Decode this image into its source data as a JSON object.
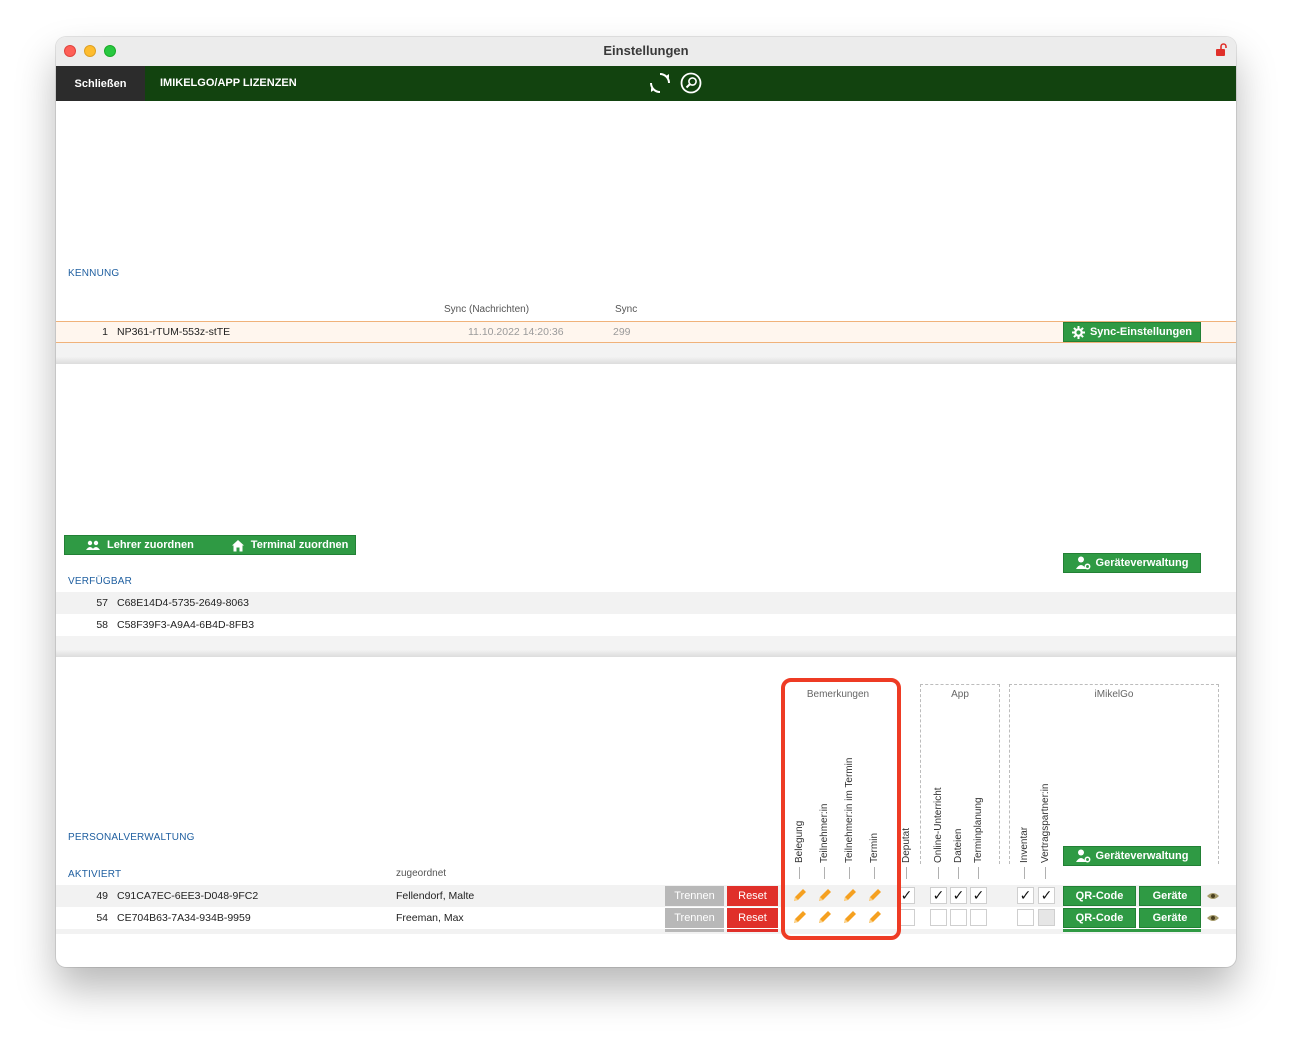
{
  "window": {
    "title": "Einstellungen"
  },
  "toolbar": {
    "close_label": "Schließen",
    "licenses_label": "IMIKELGO/APP LIZENZEN"
  },
  "kennung": {
    "label": "KENNUNG",
    "col_sync_messages": "Sync (Nachrichten)",
    "col_sync": "Sync",
    "row": {
      "num": "1",
      "id": "NP361-rTUM-553z-stTE",
      "sync_messages": "11.10.2022 14:20:36",
      "sync": "299"
    },
    "sync_settings_button": "Sync-Einstellungen"
  },
  "assign": {
    "teacher_button": "Lehrer zuordnen",
    "terminal_button": "Terminal zuordnen",
    "device_mgmt_button": "Geräteverwaltung"
  },
  "available": {
    "label": "VERFÜGBAR",
    "rows": [
      {
        "num": "57",
        "id": "C68E14D4-5735-2649-8063"
      },
      {
        "num": "58",
        "id": "C58F39F3-A9A4-6B4D-8FB3"
      }
    ]
  },
  "personnel": {
    "label": "PERSONALVERWALTUNG",
    "active_label": "AKTIVIERT",
    "assigned_header": "zugeordnet",
    "groups": {
      "remarks": "Bemerkungen",
      "app": "App",
      "imikelgo": "iMikelGo"
    },
    "columns": {
      "belegung": "Belegung",
      "teilnehmer": "Teilnehmer:in",
      "teilnehmer_termin": "Teilnehmer:in im Termin",
      "termin": "Termin",
      "deputat": "Deputat",
      "online": "Online-Unterricht",
      "dateien": "Dateien",
      "terminplanung": "Terminplanung",
      "inventar": "Inventar",
      "vertragspartner": "Vertragspartner:in"
    },
    "device_mgmt_button": "Geräteverwaltung",
    "rows": [
      {
        "num": "49",
        "id": "C91CA7EC-6EE3-D048-9FC2",
        "assigned": "Fellendorf, Malte",
        "disconnect": "Trennen",
        "reset": "Reset",
        "qr": "QR-Code",
        "devices": "Geräte",
        "deputat": true,
        "online": true,
        "dateien": true,
        "terminplanung": true,
        "inventar": true,
        "vertragspartner": true
      },
      {
        "num": "54",
        "id": "CE704B63-7A34-934B-9959",
        "assigned": "Freeman, Max",
        "disconnect": "Trennen",
        "reset": "Reset",
        "qr": "QR-Code",
        "devices": "Geräte",
        "deputat": false,
        "online": false,
        "dateien": false,
        "terminplanung": false,
        "inventar": false,
        "vertragspartner": false
      }
    ]
  },
  "colors": {
    "toolbar": "#12430f",
    "accent_green": "#2f9a44",
    "reset_red": "#e0302a",
    "highlight": "#ee3b24",
    "label_blue": "#1f5fa0",
    "pencil_orange": "#f5a020"
  }
}
